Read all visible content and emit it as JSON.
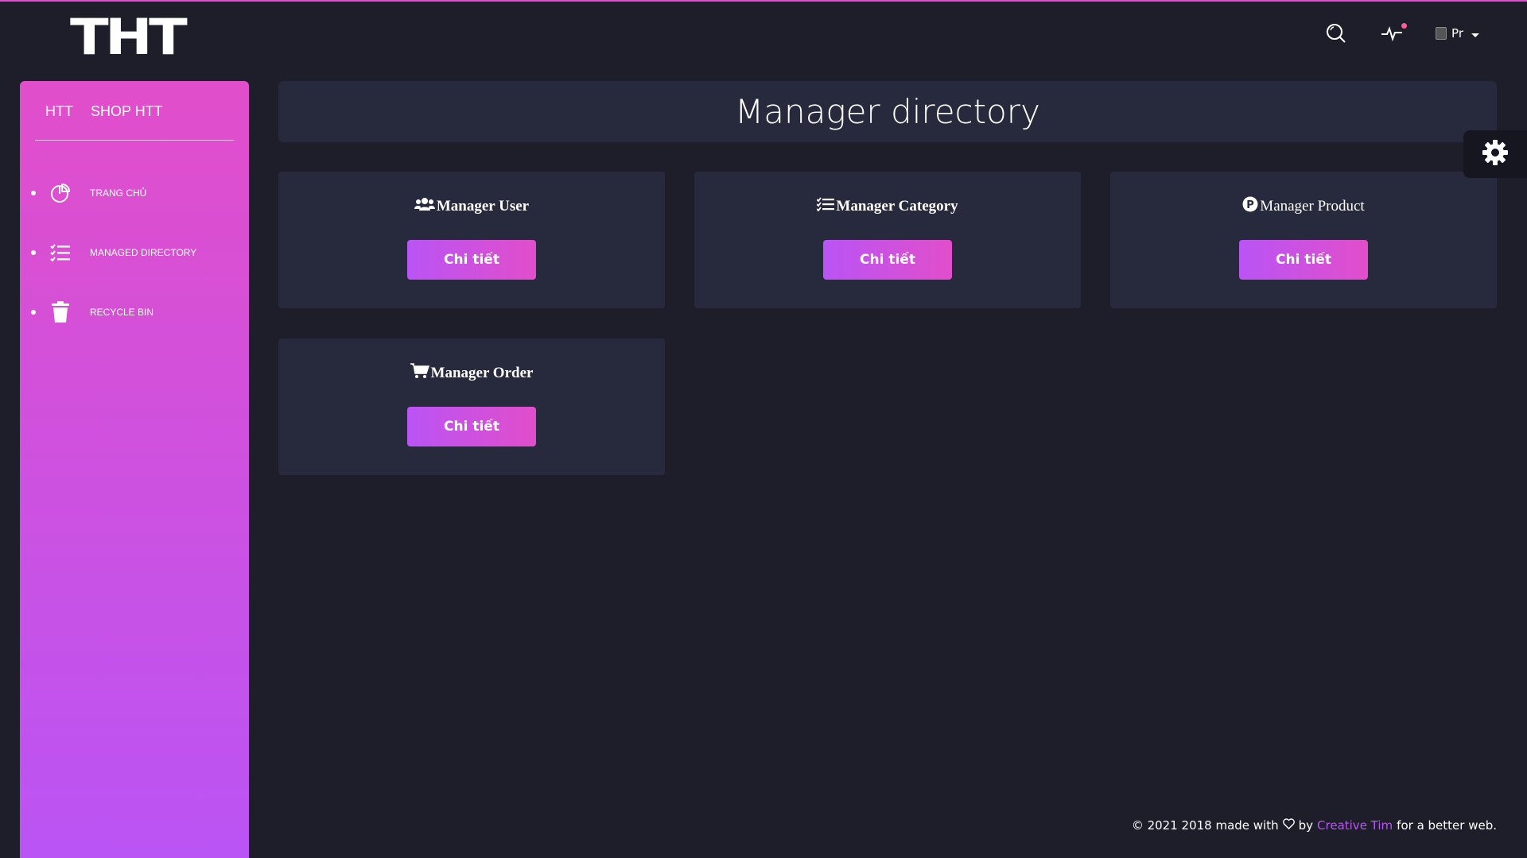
{
  "logo": {
    "text": "THT"
  },
  "topnav": {
    "search_icon": "search-icon",
    "activity_icon": "activity-icon",
    "profile_alt": "Pr",
    "notification_color": "#fd5d93"
  },
  "sidebar": {
    "brand": {
      "short": "HTT",
      "full": "SHOP HTT"
    },
    "gradient": [
      "#e14eca",
      "#ba54f5"
    ],
    "items": [
      {
        "label": "TRANG CHỦ",
        "icon": "pie-chart-icon"
      },
      {
        "label": "MANAGED DIRECTORY",
        "icon": "list-icon"
      },
      {
        "label": "RECYCLE BIN",
        "icon": "trash-icon"
      }
    ]
  },
  "main": {
    "title": "Manager directory",
    "cards": [
      {
        "title": "Manager User",
        "icon": "users-icon",
        "button": "Chi tiết"
      },
      {
        "title": "Manager Category",
        "icon": "list-icon",
        "button": "Chi tiết"
      },
      {
        "title": "Manager Product",
        "icon": "product-icon",
        "button": "Chi tiết"
      },
      {
        "title": "Manager Order",
        "icon": "cart-icon",
        "button": "Chi tiết"
      }
    ]
  },
  "footer": {
    "prefix": "© 2021 2018 made with",
    "by": "by",
    "link": "Creative Tim",
    "suffix": "for a better web."
  },
  "colors": {
    "background": "#1e1e2a",
    "card": "#272a3d",
    "accent_pink": "#e14eca",
    "accent_purple": "#ba54f5"
  }
}
